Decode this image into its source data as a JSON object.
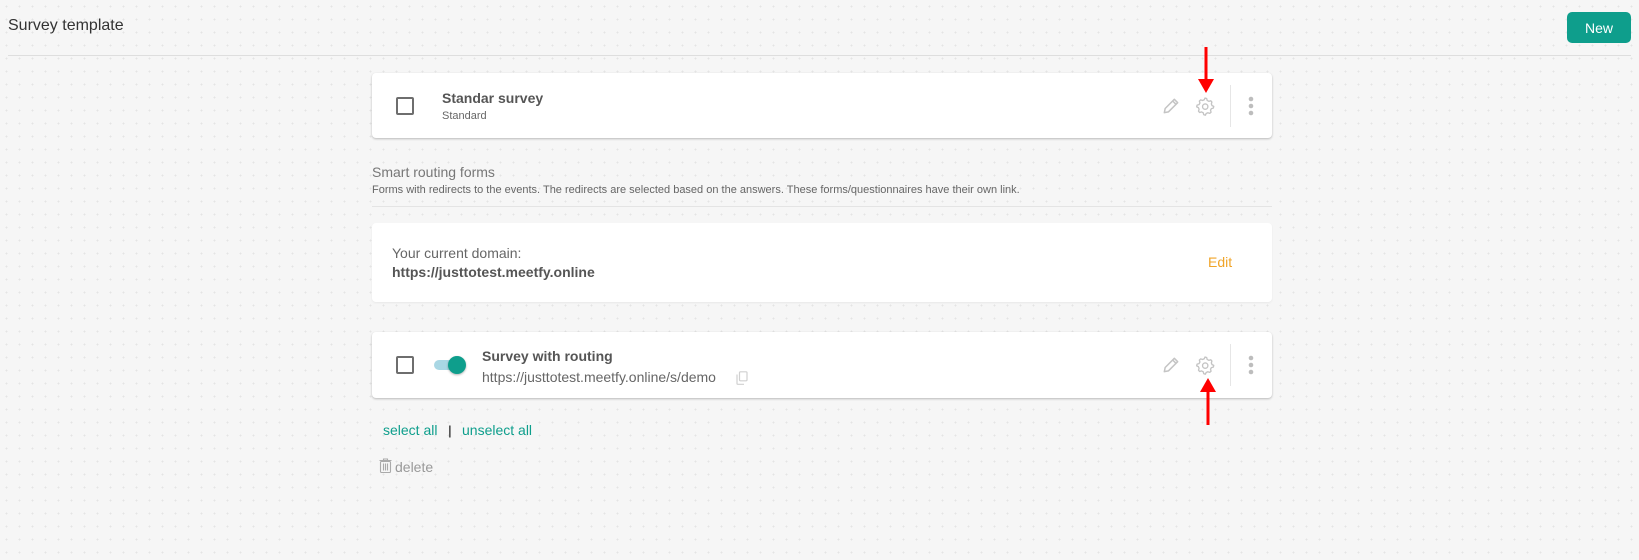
{
  "header": {
    "title": "Survey template",
    "new_button_label": "New"
  },
  "standard_survey": {
    "title": "Standar survey",
    "type": "Standard",
    "checked": false
  },
  "smart_routing": {
    "title": "Smart routing forms",
    "description": "Forms with redirects to the events. The redirects are selected based on the answers. These forms/questionnaires have their own link."
  },
  "domain": {
    "label": "Your current domain:",
    "value": "https://justtotest.meetfy.online",
    "edit_label": "Edit"
  },
  "routing_survey": {
    "title": "Survey with routing",
    "url": "https://justtotest.meetfy.online/s/demo",
    "enabled": true,
    "checked": false
  },
  "bulk_actions": {
    "select_all": "select all",
    "separator": "|",
    "unselect_all": "unselect all",
    "delete": "delete"
  },
  "colors": {
    "accent": "#0e9e8c",
    "edit_link": "#f0a428",
    "annotation_arrow": "#ff0000"
  }
}
